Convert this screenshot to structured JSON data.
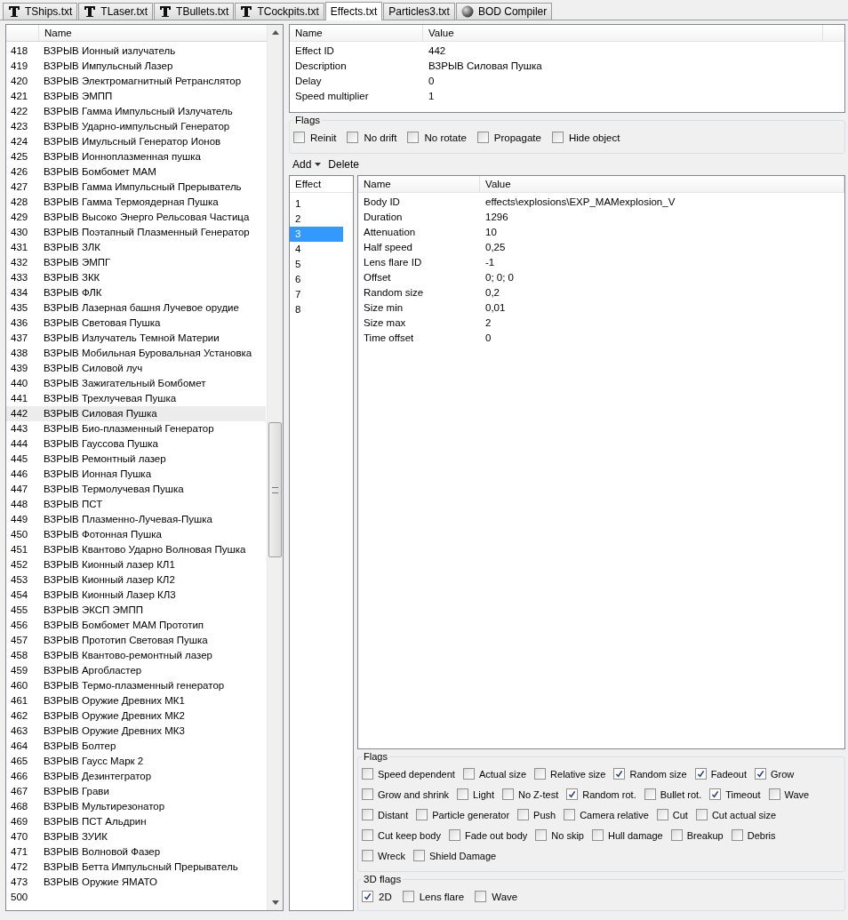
{
  "tabs": [
    {
      "label": "TShips.txt",
      "kind": "table",
      "selected": false
    },
    {
      "label": "TLaser.txt",
      "kind": "table",
      "selected": false
    },
    {
      "label": "TBullets.txt",
      "kind": "table",
      "selected": false
    },
    {
      "label": "TCockpits.txt",
      "kind": "table",
      "selected": false
    },
    {
      "label": "Effects.txt",
      "kind": "text",
      "selected": true
    },
    {
      "label": "Particles3.txt",
      "kind": "text",
      "selected": false
    },
    {
      "label": "BOD Compiler",
      "kind": "compiler",
      "selected": false
    }
  ],
  "effects_list": {
    "column": "Name",
    "rows": [
      {
        "id": "418",
        "name": "ВЗРЫВ Ионный излучатель",
        "selected": false
      },
      {
        "id": "419",
        "name": "ВЗРЫВ Импульсный Лазер",
        "selected": false
      },
      {
        "id": "420",
        "name": "ВЗРЫВ Электромагнитный Ретранслятор",
        "selected": false
      },
      {
        "id": "421",
        "name": "ВЗРЫВ ЭМПП",
        "selected": false
      },
      {
        "id": "422",
        "name": "ВЗРЫВ Гамма Импульсный Излучатель",
        "selected": false
      },
      {
        "id": "423",
        "name": "ВЗРЫВ Ударно-импульсный Генератор",
        "selected": false
      },
      {
        "id": "424",
        "name": "ВЗРЫВ Имульсный Генератор Ионов",
        "selected": false
      },
      {
        "id": "425",
        "name": "ВЗРЫВ Ионноплазменная пушка",
        "selected": false
      },
      {
        "id": "426",
        "name": "ВЗРЫВ Бомбомет МАМ",
        "selected": false
      },
      {
        "id": "427",
        "name": "ВЗРЫВ Гамма Импульсный Прерыватель",
        "selected": false
      },
      {
        "id": "428",
        "name": "ВЗРЫВ Гамма Термоядерная Пушка",
        "selected": false
      },
      {
        "id": "429",
        "name": "ВЗРЫВ Высоко Энерго Рельсовая Частица",
        "selected": false
      },
      {
        "id": "430",
        "name": "ВЗРЫВ Поэтапный Плазменный Генератор",
        "selected": false
      },
      {
        "id": "431",
        "name": "ВЗРЫВ ЗЛК",
        "selected": false
      },
      {
        "id": "432",
        "name": "ВЗРЫВ ЭМПГ",
        "selected": false
      },
      {
        "id": "433",
        "name": "ВЗРЫВ ЗКК",
        "selected": false
      },
      {
        "id": "434",
        "name": "ВЗРЫВ ФЛК",
        "selected": false
      },
      {
        "id": "435",
        "name": "ВЗРЫВ Лазерная башня Лучевое орудие",
        "selected": false
      },
      {
        "id": "436",
        "name": "ВЗРЫВ Световая Пушка",
        "selected": false
      },
      {
        "id": "437",
        "name": "ВЗРЫВ Излучатель Темной Материи",
        "selected": false
      },
      {
        "id": "438",
        "name": "ВЗРЫВ Мобильная Буровальная Установка",
        "selected": false
      },
      {
        "id": "439",
        "name": "ВЗРЫВ Силовой луч",
        "selected": false
      },
      {
        "id": "440",
        "name": "ВЗРЫВ Зажигательный Бомбомет",
        "selected": false
      },
      {
        "id": "441",
        "name": "ВЗРЫВ Трехлучевая Пушка",
        "selected": false
      },
      {
        "id": "442",
        "name": "ВЗРЫВ Силовая Пушка",
        "selected": true
      },
      {
        "id": "443",
        "name": "ВЗРЫВ Био-плазменный Генератор",
        "selected": false
      },
      {
        "id": "444",
        "name": "ВЗРЫВ Гауссова Пушка",
        "selected": false
      },
      {
        "id": "445",
        "name": "ВЗРЫВ Ремонтный лазер",
        "selected": false
      },
      {
        "id": "446",
        "name": "ВЗРЫВ Ионная Пушка",
        "selected": false
      },
      {
        "id": "447",
        "name": "ВЗРЫВ Термолучевая Пушка",
        "selected": false
      },
      {
        "id": "448",
        "name": "ВЗРЫВ ПСТ",
        "selected": false
      },
      {
        "id": "449",
        "name": "ВЗРЫВ Плазменно-Лучевая-Пушка",
        "selected": false
      },
      {
        "id": "450",
        "name": "ВЗРЫВ Фотонная Пушка",
        "selected": false
      },
      {
        "id": "451",
        "name": "ВЗРЫВ Квантово Ударно Волновая Пушка",
        "selected": false
      },
      {
        "id": "452",
        "name": "ВЗРЫВ Кионный лазер КЛ1",
        "selected": false
      },
      {
        "id": "453",
        "name": "ВЗРЫВ Кионный лазер КЛ2",
        "selected": false
      },
      {
        "id": "454",
        "name": "ВЗРЫВ Кионный Лазер КЛ3",
        "selected": false
      },
      {
        "id": "455",
        "name": "ВЗРЫВ ЭКСП ЭМПП",
        "selected": false
      },
      {
        "id": "456",
        "name": "ВЗРЫВ Бомбомет МАМ Прототип",
        "selected": false
      },
      {
        "id": "457",
        "name": "ВЗРЫВ Прототип Световая Пушка",
        "selected": false
      },
      {
        "id": "458",
        "name": "ВЗРЫВ Квантово-ремонтный лазер",
        "selected": false
      },
      {
        "id": "459",
        "name": "ВЗРЫВ Аргобластер",
        "selected": false
      },
      {
        "id": "460",
        "name": "ВЗРЫВ Термо-плазменный генератор",
        "selected": false
      },
      {
        "id": "461",
        "name": "ВЗРЫВ Оружие Древних МК1",
        "selected": false
      },
      {
        "id": "462",
        "name": "ВЗРЫВ Оружие Древних МК2",
        "selected": false
      },
      {
        "id": "463",
        "name": "ВЗРЫВ Оружие Древних МК3",
        "selected": false
      },
      {
        "id": "464",
        "name": "ВЗРЫВ Болтер",
        "selected": false
      },
      {
        "id": "465",
        "name": "ВЗРЫВ Гаусс Марк 2",
        "selected": false
      },
      {
        "id": "466",
        "name": "ВЗРЫВ Дезинтегратор",
        "selected": false
      },
      {
        "id": "467",
        "name": "ВЗРЫВ Грави",
        "selected": false
      },
      {
        "id": "468",
        "name": "ВЗРЫВ Мультирезонатор",
        "selected": false
      },
      {
        "id": "469",
        "name": "ВЗРЫВ ПСТ Альдрин",
        "selected": false
      },
      {
        "id": "470",
        "name": "ВЗРЫВ ЗУИК",
        "selected": false
      },
      {
        "id": "471",
        "name": "ВЗРЫВ Волновой Фазер",
        "selected": false
      },
      {
        "id": "472",
        "name": "ВЗРЫВ Бетта Импульсный Прерыватель",
        "selected": false
      },
      {
        "id": "473",
        "name": "ВЗРЫВ Оружие ЯМАТО",
        "selected": false
      },
      {
        "id": "500",
        "selected": false
      }
    ]
  },
  "properties": {
    "columns": [
      "Name",
      "Value"
    ],
    "rows": [
      {
        "name": "Effect ID",
        "value": "442"
      },
      {
        "name": "Description",
        "value": "ВЗРЫВ Силовая Пушка"
      },
      {
        "name": "Delay",
        "value": "0"
      },
      {
        "name": "Speed multiplier",
        "value": "1"
      }
    ]
  },
  "flags": {
    "title": "Flags",
    "items": [
      {
        "label": "Reinit",
        "checked": false
      },
      {
        "label": "No drift",
        "checked": false
      },
      {
        "label": "No rotate",
        "checked": false
      },
      {
        "label": "Propagate",
        "checked": false
      },
      {
        "label": "Hide object",
        "checked": false
      }
    ]
  },
  "toolbar": {
    "add": "Add",
    "delete": "Delete"
  },
  "sub_effects": {
    "column": "Effect",
    "items": [
      {
        "label": "1",
        "selected": false
      },
      {
        "label": "2",
        "selected": false
      },
      {
        "label": "3",
        "selected": true
      },
      {
        "label": "4",
        "selected": false
      },
      {
        "label": "5",
        "selected": false
      },
      {
        "label": "6",
        "selected": false
      },
      {
        "label": "7",
        "selected": false
      },
      {
        "label": "8",
        "selected": false
      }
    ]
  },
  "sub_properties": {
    "columns": [
      "Name",
      "Value"
    ],
    "rows": [
      {
        "name": "Body ID",
        "value": "effects\\explosions\\EXP_MAMexplosion_V"
      },
      {
        "name": "Duration",
        "value": "1296"
      },
      {
        "name": "Attenuation",
        "value": "10"
      },
      {
        "name": "Half speed",
        "value": "0,25"
      },
      {
        "name": "Lens flare ID",
        "value": "-1"
      },
      {
        "name": "Offset",
        "value": "0; 0; 0"
      },
      {
        "name": "Random size",
        "value": "0,2"
      },
      {
        "name": "Size min",
        "value": "0,01"
      },
      {
        "name": "Size max",
        "value": "2"
      },
      {
        "name": "Time offset",
        "value": "0"
      }
    ]
  },
  "sub_flags": {
    "title": "Flags",
    "rows": [
      [
        {
          "label": "Speed dependent",
          "checked": false
        },
        {
          "label": "Actual size",
          "checked": false
        },
        {
          "label": "Relative size",
          "checked": false
        },
        {
          "label": "Random size",
          "checked": true
        },
        {
          "label": "Fadeout",
          "checked": true
        },
        {
          "label": "Grow",
          "checked": true
        }
      ],
      [
        {
          "label": "Grow and shrink",
          "checked": false
        },
        {
          "label": "Light",
          "checked": false
        },
        {
          "label": "No Z-test",
          "checked": false
        },
        {
          "label": "Random rot.",
          "checked": true
        },
        {
          "label": "Bullet rot.",
          "checked": false
        },
        {
          "label": "Timeout",
          "checked": true
        },
        {
          "label": "Wave",
          "checked": false
        }
      ],
      [
        {
          "label": "Distant",
          "checked": false
        },
        {
          "label": "Particle generator",
          "checked": false
        },
        {
          "label": "Push",
          "checked": false
        },
        {
          "label": "Camera relative",
          "checked": false
        },
        {
          "label": "Cut",
          "checked": false
        },
        {
          "label": "Cut actual size",
          "checked": false
        }
      ],
      [
        {
          "label": "Cut keep body",
          "checked": false
        },
        {
          "label": "Fade out body",
          "checked": false
        },
        {
          "label": "No skip",
          "checked": false
        },
        {
          "label": "Hull damage",
          "checked": false
        },
        {
          "label": "Breakup",
          "checked": false
        },
        {
          "label": "Debris",
          "checked": false
        }
      ],
      [
        {
          "label": "Wreck",
          "checked": false
        },
        {
          "label": "Shield Damage",
          "checked": false
        }
      ]
    ]
  },
  "flags_3d": {
    "title": "3D flags",
    "items": [
      {
        "label": "2D",
        "checked": true
      },
      {
        "label": "Lens flare",
        "checked": false
      },
      {
        "label": "Wave",
        "checked": false
      }
    ]
  }
}
